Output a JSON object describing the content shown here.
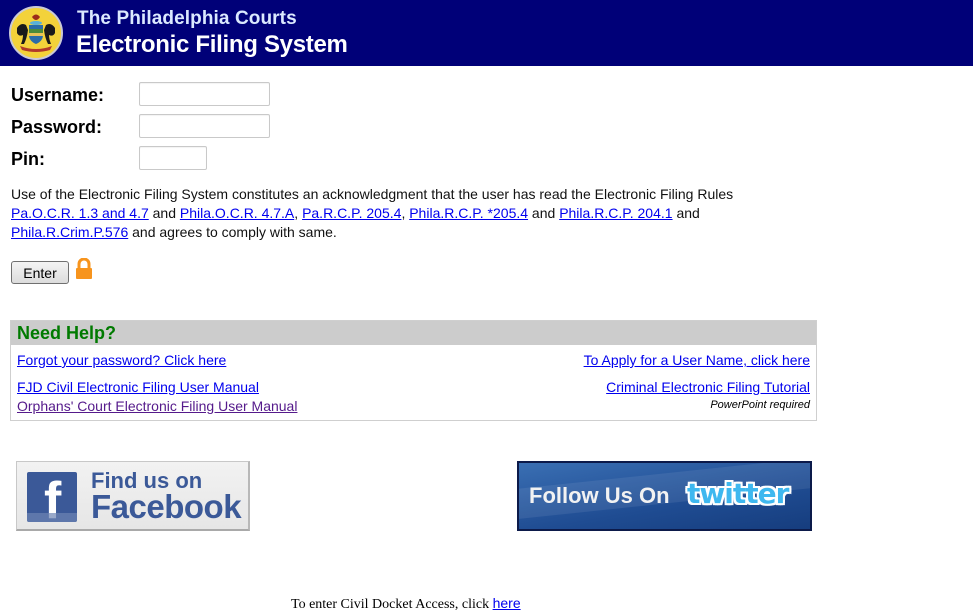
{
  "header": {
    "line1": "The Philadelphia Courts",
    "line2": "Electronic Filing System",
    "seal_icon": "pennsylvania-coat-of-arms-seal",
    "background_color": "#000078"
  },
  "login": {
    "username_label": "Username:",
    "username_value": "",
    "password_label": "Password:",
    "password_value": "",
    "pin_label": "Pin:",
    "pin_value": ""
  },
  "legal": {
    "text_1": "Use of the Electronic Filing System constitutes an acknowledgment that the user has read the Electronic Filing Rules ",
    "links": [
      "Pa.O.C.R. 1.3 and 4.7",
      "Phila.O.C.R. 4.7.A",
      "Pa.R.C.P. 205.4",
      "Phila.R.C.P. *205.4",
      "Phila.R.C.P. 204.1",
      "Phila.R.Crim.P.576"
    ],
    "sep_and_1": " and ",
    "sep_comma_1": ", ",
    "sep_comma_2": ", ",
    "sep_and_2": " and ",
    "sep_and_3": " and ",
    "text_end": " and agrees to comply with same."
  },
  "actions": {
    "enter_label": "Enter",
    "lock_icon": "padlock-icon",
    "lock_color": "#f7941d"
  },
  "help": {
    "title": "Need Help?",
    "title_color": "#007a00",
    "forgot_password": "Forgot your password? Click here",
    "apply_username": "To Apply for a User Name, click here",
    "civil_manual": "FJD Civil Electronic Filing User Manual",
    "criminal_tutorial": "Criminal Electronic Filing Tutorial",
    "orphans_manual": "Orphans' Court Electronic Filing User Manual",
    "powerpoint_note": "PowerPoint required"
  },
  "social": {
    "facebook_line1": "Find us on",
    "facebook_line2": "Facebook",
    "facebook_glyph": "f",
    "twitter_follow": "Follow Us On",
    "twitter_word": "twitter"
  },
  "footer": {
    "text": "To enter Civil Docket Access, click ",
    "link": "here"
  }
}
